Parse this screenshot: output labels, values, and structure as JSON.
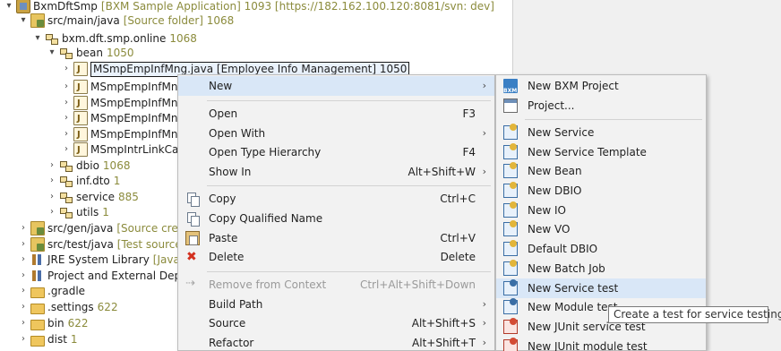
{
  "tree": {
    "project": {
      "name": "BxmDftSmp",
      "decoration": "[BXM Sample Application] 1093 [https://182.162.100.120:8081/svn: dev]"
    },
    "src_main": {
      "name": "src/main/java",
      "decoration": "[Source folder] 1068"
    },
    "package": {
      "name": "bxm.dft.smp.online",
      "decoration": "1068"
    },
    "bean": {
      "name": "bean",
      "decoration": "1050"
    },
    "bean_files": [
      {
        "name": "MSmpEmpInfMng.java [Employee Info Management] 1050"
      },
      {
        "name": "MSmpEmpInfMng"
      },
      {
        "name": "MSmpEmpInfMng"
      },
      {
        "name": "MSmpEmpInfMng"
      },
      {
        "name": "MSmpEmpInfMng"
      },
      {
        "name": "MSmpIntrLinkCall"
      }
    ],
    "subpackages": [
      {
        "name": "dbio",
        "decoration": "1068"
      },
      {
        "name": "inf.dto",
        "decoration": "1"
      },
      {
        "name": "service",
        "decoration": "885"
      },
      {
        "name": "utils",
        "decoration": "1"
      }
    ],
    "roots": [
      {
        "name": "src/gen/java",
        "decoration": "[Source creati"
      },
      {
        "name": "src/test/java",
        "decoration": "[Test source fo"
      },
      {
        "name": "JRE System Library",
        "decoration": "[JavaSE"
      },
      {
        "name": "Project and External Depen",
        "decoration": ""
      },
      {
        "name": ".gradle",
        "decoration": ""
      },
      {
        "name": ".settings",
        "decoration": "622"
      },
      {
        "name": "bin",
        "decoration": "622"
      },
      {
        "name": "dist",
        "decoration": "1"
      }
    ]
  },
  "context_menu": {
    "items": [
      {
        "label": "New",
        "key": "",
        "submenu": true
      },
      {
        "label": "Open",
        "key": "F3",
        "submenu": false
      },
      {
        "label": "Open With",
        "key": "",
        "submenu": true
      },
      {
        "label": "Open Type Hierarchy",
        "key": "F4",
        "submenu": false
      },
      {
        "label": "Show In",
        "key": "Alt+Shift+W",
        "submenu": true
      },
      {
        "label": "Copy",
        "key": "Ctrl+C",
        "submenu": false,
        "icon": "copy-icon"
      },
      {
        "label": "Copy Qualified Name",
        "key": "",
        "submenu": false,
        "icon": "copy-qualified-icon"
      },
      {
        "label": "Paste",
        "key": "Ctrl+V",
        "submenu": false,
        "icon": "paste-icon"
      },
      {
        "label": "Delete",
        "key": "Delete",
        "submenu": false,
        "icon": "delete-icon"
      },
      {
        "label": "Remove from Context",
        "key": "Ctrl+Alt+Shift+Down",
        "submenu": false,
        "disabled": true,
        "icon": "remove-context-icon"
      },
      {
        "label": "Build Path",
        "key": "",
        "submenu": true
      },
      {
        "label": "Source",
        "key": "Alt+Shift+S",
        "submenu": true
      },
      {
        "label": "Refactor",
        "key": "Alt+Shift+T",
        "submenu": true
      }
    ]
  },
  "new_submenu": {
    "items": [
      {
        "label": "New BXM Project",
        "icon": "bxm-project-icon"
      },
      {
        "label": "Project...",
        "icon": "project-icon"
      },
      {
        "label": "New Service",
        "icon": "service-icon"
      },
      {
        "label": "New Service Template",
        "icon": "service-template-icon"
      },
      {
        "label": "New Bean",
        "icon": "bean-icon"
      },
      {
        "label": "New DBIO",
        "icon": "dbio-icon"
      },
      {
        "label": "New IO",
        "icon": "io-icon"
      },
      {
        "label": "New VO",
        "icon": "vo-icon"
      },
      {
        "label": "Default DBIO",
        "icon": "default-dbio-icon"
      },
      {
        "label": "New Batch Job",
        "icon": "batch-job-icon"
      },
      {
        "label": "New Service test",
        "icon": "service-test-icon"
      },
      {
        "label": "New Module test",
        "icon": "module-test-icon"
      },
      {
        "label": "New JUnit service test",
        "icon": "junit-service-test-icon"
      },
      {
        "label": "New JUnit module test",
        "icon": "junit-module-test-icon"
      }
    ]
  },
  "tooltip": {
    "text": "Create a test for service testing."
  },
  "arrow_glyph": "›"
}
